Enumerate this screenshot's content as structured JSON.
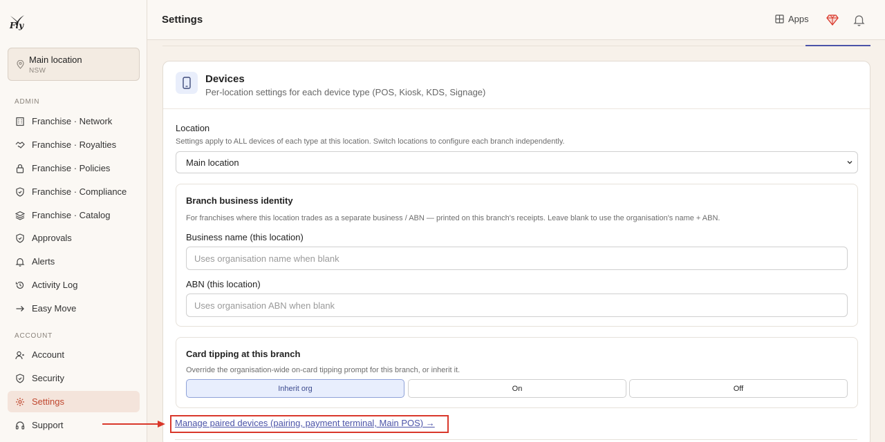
{
  "app": {
    "logo_text": "Fly"
  },
  "sidebar": {
    "location": {
      "name": "Main location",
      "sub": "NSW"
    },
    "admin_label": "ADMIN",
    "admin_items": [
      {
        "label": "Franchise · Network",
        "icon": "building-icon"
      },
      {
        "label": "Franchise · Royalties",
        "icon": "handshake-icon"
      },
      {
        "label": "Franchise · Policies",
        "icon": "lock-icon"
      },
      {
        "label": "Franchise · Compliance",
        "icon": "shield-icon"
      },
      {
        "label": "Franchise · Catalog",
        "icon": "layers-icon"
      },
      {
        "label": "Approvals",
        "icon": "shield-check-icon"
      },
      {
        "label": "Alerts",
        "icon": "bell-icon"
      },
      {
        "label": "Activity Log",
        "icon": "history-icon"
      },
      {
        "label": "Easy Move",
        "icon": "arrow-right-icon"
      }
    ],
    "account_label": "ACCOUNT",
    "account_items": [
      {
        "label": "Account",
        "icon": "user-icon"
      },
      {
        "label": "Security",
        "icon": "shield-icon"
      },
      {
        "label": "Settings",
        "icon": "gear-icon",
        "active": true
      },
      {
        "label": "Support",
        "icon": "headset-icon"
      }
    ]
  },
  "header": {
    "title": "Settings",
    "apps_label": "Apps"
  },
  "devices": {
    "title": "Devices",
    "subtitle": "Per-location settings for each device type (POS, Kiosk, KDS, Signage)",
    "location_label": "Location",
    "location_hint": "Settings apply to ALL devices of each type at this location. Switch locations to configure each branch independently.",
    "location_value": "Main location",
    "identity": {
      "title": "Branch business identity",
      "hint": "For franchises where this location trades as a separate business / ABN — printed on this branch's receipts. Leave blank to use the organisation's name + ABN.",
      "business_name_label": "Business name (this location)",
      "business_name_placeholder": "Uses organisation name when blank",
      "business_name_value": "",
      "abn_label": "ABN (this location)",
      "abn_placeholder": "Uses organisation ABN when blank",
      "abn_value": ""
    },
    "tipping": {
      "title": "Card tipping at this branch",
      "hint": "Override the organisation-wide on-card tipping prompt for this branch, or inherit it.",
      "options": [
        "Inherit org",
        "On",
        "Off"
      ],
      "selected": "Inherit org"
    },
    "manage_link": "Manage paired devices (pairing, payment terminal, Main POS) →"
  },
  "colors": {
    "accent": "#4b53a8",
    "active_nav": "#c0472f",
    "annotation": "#d9372a"
  }
}
